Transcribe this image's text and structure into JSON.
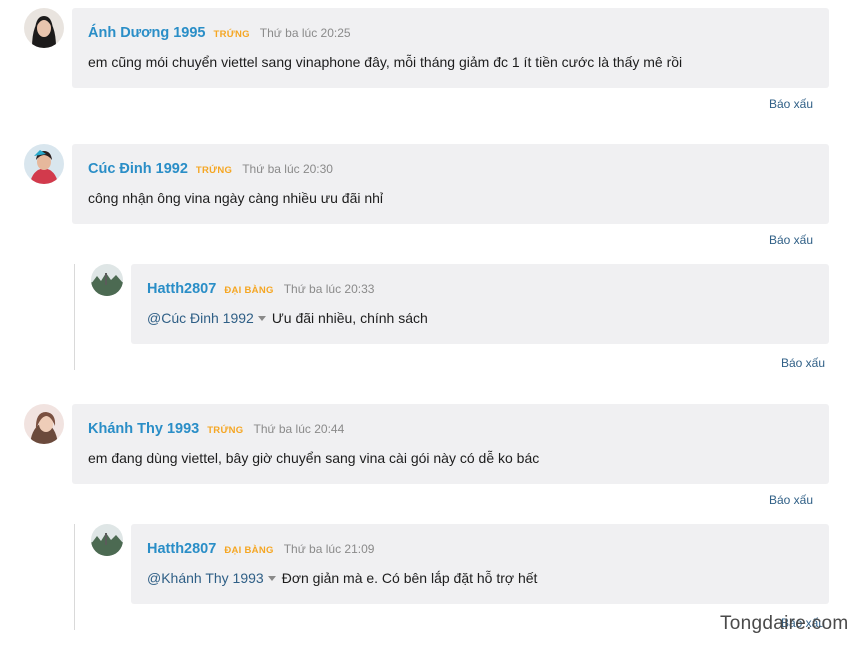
{
  "report_label": "Báo xấu",
  "watermark": "Tongdaire.com",
  "comments": [
    {
      "author": "Ánh Dương 1995",
      "badge": "TRỨNG",
      "time": "Thứ ba lúc 20:25",
      "text": "em cũng mói chuyển viettel sang vinaphone đây, mỗi tháng giảm đc 1 ít tiền cước là thấy mê rồi",
      "avatar_icon": "user-photo-avatar"
    },
    {
      "author": "Cúc Đinh 1992",
      "badge": "TRỨNG",
      "time": "Thứ ba lúc 20:30",
      "text": "công nhận ông vina ngày càng nhiều ưu đãi nhỉ",
      "avatar_icon": "user-photo-avatar",
      "reply": {
        "author": "Hatth2807",
        "badge": "ĐẠI BÀNG",
        "time": "Thứ ba lúc 20:33",
        "mention": "@Cúc Đinh 1992",
        "text": "Ưu đãi nhiều, chính sách",
        "avatar_icon": "landscape-avatar"
      }
    },
    {
      "author": "Khánh Thy 1993",
      "badge": "TRỨNG",
      "time": "Thứ ba lúc 20:44",
      "text": "em đang dùng viettel, bây giờ chuyển sang vina cài gói này có dễ ko bác",
      "avatar_icon": "user-photo-avatar",
      "reply": {
        "author": "Hatth2807",
        "badge": "ĐẠI BÀNG",
        "time": "Thứ ba lúc 21:09",
        "mention": "@Khánh Thy 1993",
        "text": "Đơn giản mà e. Có bên lắp đặt hỗ trợ hết",
        "avatar_icon": "landscape-avatar"
      }
    }
  ]
}
